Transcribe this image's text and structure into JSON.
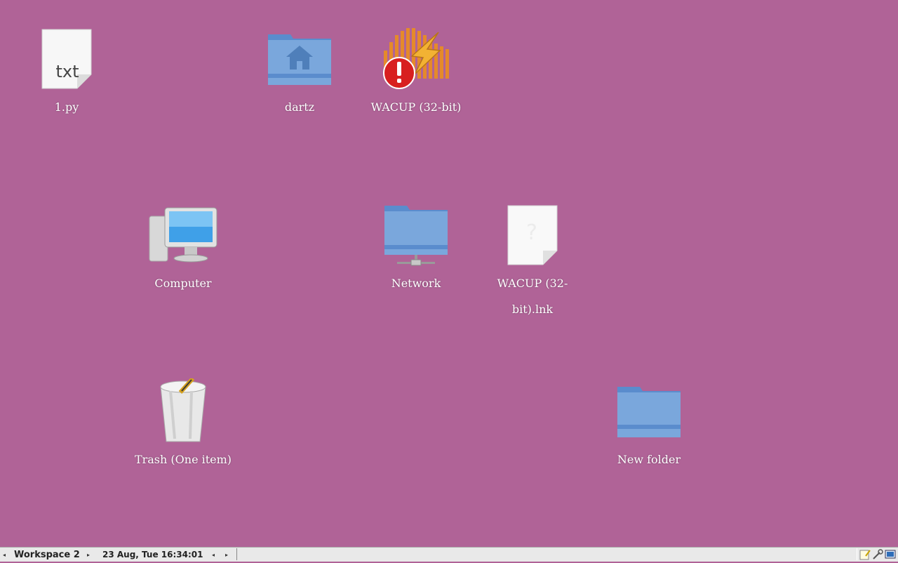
{
  "desktop": {
    "background_color": "#b06397",
    "icons": [
      {
        "label": "1.py",
        "icon": "text-file-icon",
        "badge_text": "txt"
      },
      {
        "label": "dartz",
        "icon": "home-folder-icon"
      },
      {
        "label": "WACUP (32-bit)",
        "icon": "wacup-app-icon-with-error-badge"
      },
      {
        "label": "Computer",
        "icon": "computer-icon"
      },
      {
        "label": "Network",
        "icon": "network-folder-icon"
      },
      {
        "label": "WACUP (32-bit).lnk",
        "icon": "unknown-file-icon"
      },
      {
        "label": "Trash (One item)",
        "icon": "trash-full-icon"
      },
      {
        "label": "New folder",
        "icon": "folder-icon"
      }
    ]
  },
  "taskbar": {
    "workspace_label": "Workspace 2",
    "clock": "23 Aug, Tue 16:34:01",
    "prev_arrow": "◂",
    "next_arrow": "▸"
  }
}
